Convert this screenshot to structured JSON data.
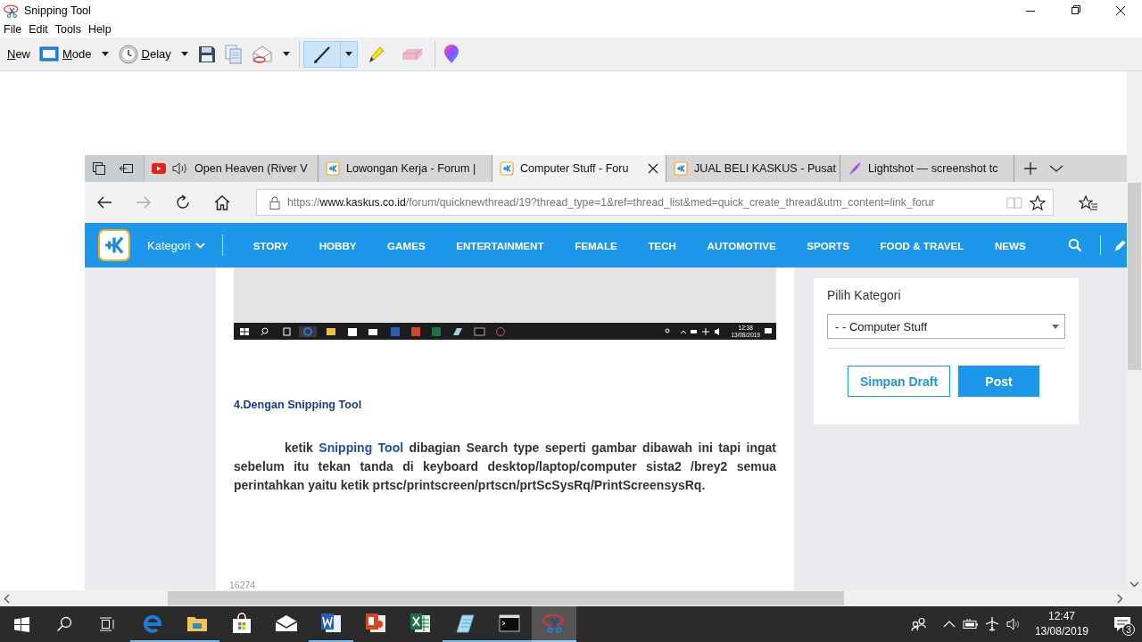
{
  "window": {
    "title": "Snipping Tool"
  },
  "menu": [
    "File",
    "Edit",
    "Tools",
    "Help"
  ],
  "toolbar": {
    "actions": [
      {
        "kind": "new",
        "label": "New",
        "dropdown": false
      },
      {
        "kind": "mode",
        "label": "Mode",
        "dropdown": true
      },
      {
        "kind": "delay",
        "label": "Delay",
        "dropdown": true
      },
      {
        "kind": "save",
        "dropdown": false
      },
      {
        "kind": "copy",
        "dropdown": false
      },
      {
        "kind": "send",
        "dropdown": true
      }
    ],
    "tools": [
      {
        "kind": "pen",
        "selected": true,
        "dropdown": true
      },
      {
        "kind": "highlighter",
        "selected": false,
        "dropdown": false
      },
      {
        "kind": "eraser",
        "selected": false,
        "dropdown": false
      }
    ]
  },
  "browser": {
    "tabs": [
      {
        "kind": "youtube",
        "title": "Open Heaven (River V",
        "audio": true,
        "selected": false
      },
      {
        "kind": "kaskus",
        "title": "Lowongan Kerja - Forum |",
        "audio": false,
        "selected": false
      },
      {
        "kind": "kaskus",
        "title": "Computer Stuff - Foru",
        "audio": false,
        "selected": true
      },
      {
        "kind": "kaskus",
        "title": "JUAL BELI KASKUS - Pusat",
        "audio": false,
        "selected": false
      },
      {
        "kind": "feather",
        "title": "Lightshot — screenshot tc",
        "audio": false,
        "selected": false
      }
    ],
    "nav_buttons": [
      {
        "kind": "back",
        "disabled": false
      },
      {
        "kind": "forward",
        "disabled": true
      },
      {
        "kind": "refresh",
        "disabled": false
      },
      {
        "kind": "home",
        "disabled": false
      }
    ],
    "address": {
      "scheme": "https://",
      "host": "www.kaskus.co.id",
      "path": "/forum/quicknewthread/19?thread_type=1&ref=thread_list&med=quick_create_thread&utm_content=link_forur"
    }
  },
  "site_nav": {
    "category": "Kategori",
    "items": [
      "STORY",
      "HOBBY",
      "GAMES",
      "ENTERTAINMENT",
      "FEMALE",
      "TECH",
      "AUTOMOTIVE",
      "SPORTS",
      "FOOD & TRAVEL",
      "NEWS"
    ]
  },
  "article": {
    "embedded_screenshot": {
      "clock_time": "12:38",
      "clock_date": "13/08/2019"
    },
    "heading": "4.Dengan Snipping Tool",
    "paragraph": {
      "before": "ketik ",
      "link": "Snipping Tool",
      "after": "  dibagian Search type seperti gambar dibawah ini tapi ingat sebelum itu tekan tanda di keyboard desktop/laptop/computer sista2 /brey2 semua perintahkan yaitu ketik prtsc/printscreen/prtscn/prtScSysRq/PrintScreensysRq."
    },
    "footer_number": "16274"
  },
  "sidebar": {
    "title": "Pilih Kategori",
    "category_select": "- - Computer Stuff",
    "buttons": [
      {
        "kind": "outline",
        "label": "Simpan Draft"
      },
      {
        "kind": "primary",
        "label": "Post"
      }
    ]
  },
  "taskbar": {
    "apps": [
      {
        "kind": "edge",
        "running": true,
        "active": false
      },
      {
        "kind": "explorer",
        "running": true,
        "active": false
      },
      {
        "kind": "store",
        "running": false,
        "active": false
      },
      {
        "kind": "mail",
        "running": false,
        "active": false
      },
      {
        "kind": "word",
        "running": true,
        "active": false
      },
      {
        "kind": "powerpoint",
        "running": false,
        "active": false
      },
      {
        "kind": "excel",
        "running": false,
        "active": false
      },
      {
        "kind": "notepad",
        "running": true,
        "active": false
      },
      {
        "kind": "cmd",
        "running": true,
        "active": false
      },
      {
        "kind": "snipping",
        "running": true,
        "active": true
      }
    ],
    "clock_time": "12:47",
    "clock_date": "13/08/2019",
    "notification_count": "3"
  }
}
